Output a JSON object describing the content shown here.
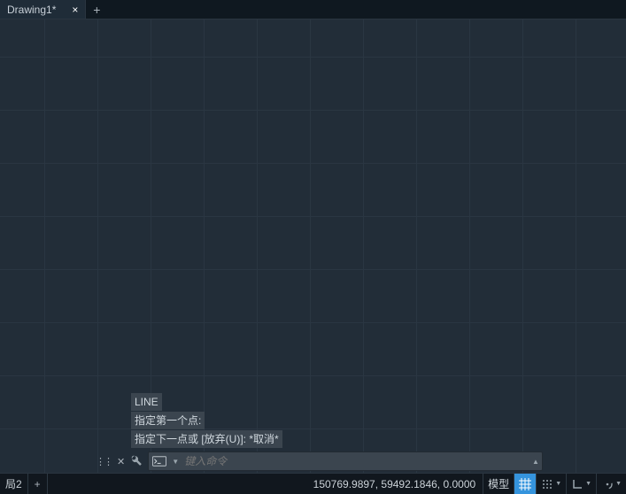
{
  "tabs": {
    "active_label": "Drawing1*"
  },
  "cmd_history": {
    "l0": "LINE",
    "l1": "指定第一个点:",
    "l2": "指定下一点或 [放弃(U)]: *取消*"
  },
  "cmd_input": {
    "placeholder": "键入命令"
  },
  "status": {
    "layout_tab": "局2",
    "coords": "150769.9897, 59492.1846, 0.0000",
    "model_label": "模型"
  }
}
